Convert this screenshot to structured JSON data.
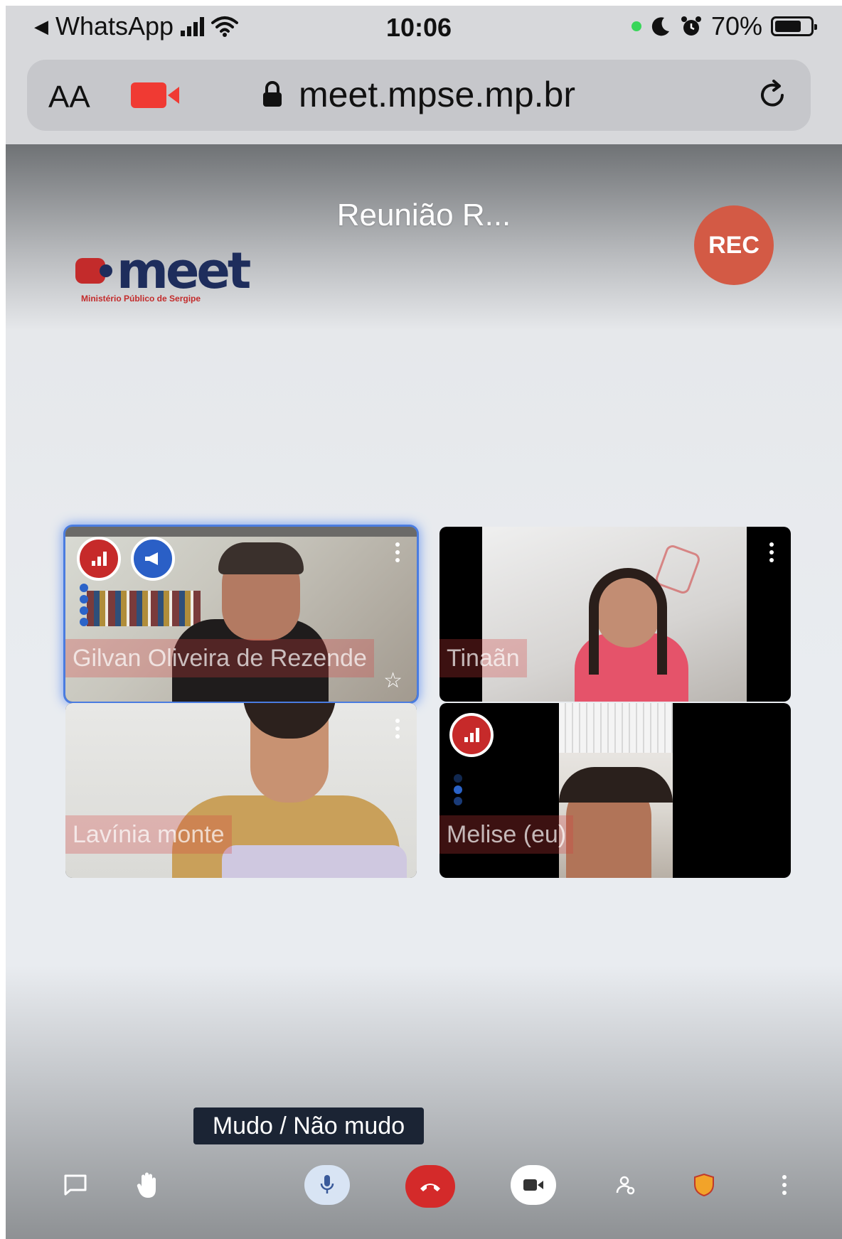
{
  "status_bar": {
    "back_app": "WhatsApp",
    "time": "10:06",
    "battery": "70%"
  },
  "browser": {
    "text_size_label": "AA",
    "url": "meet.mpse.mp.br"
  },
  "meeting": {
    "title": "Reunião R...",
    "rec_label": "REC",
    "logo_word": "meet",
    "logo_subtitle": "Ministério Público de Sergipe"
  },
  "participants": [
    {
      "name": "Gilvan Oliveira de Rezende",
      "active_speaker": true
    },
    {
      "name": "Tinaãn",
      "active_speaker": false
    },
    {
      "name": "Lavínia monte",
      "active_speaker": false
    },
    {
      "name": "Melise (eu)",
      "active_speaker": false
    }
  ],
  "tooltip": "Mudo / Não mudo",
  "toolbar": {
    "icons": [
      "chat-icon",
      "raise-hand-icon",
      "microphone-icon",
      "hangup-icon",
      "camera-icon",
      "participants-icon",
      "security-shield-icon",
      "more-icon"
    ]
  },
  "colors": {
    "rec": "#d35a45",
    "hangup": "#d42a2a",
    "active_tile_border": "#4a7ce0",
    "tooltip_bg": "#1b2434"
  }
}
